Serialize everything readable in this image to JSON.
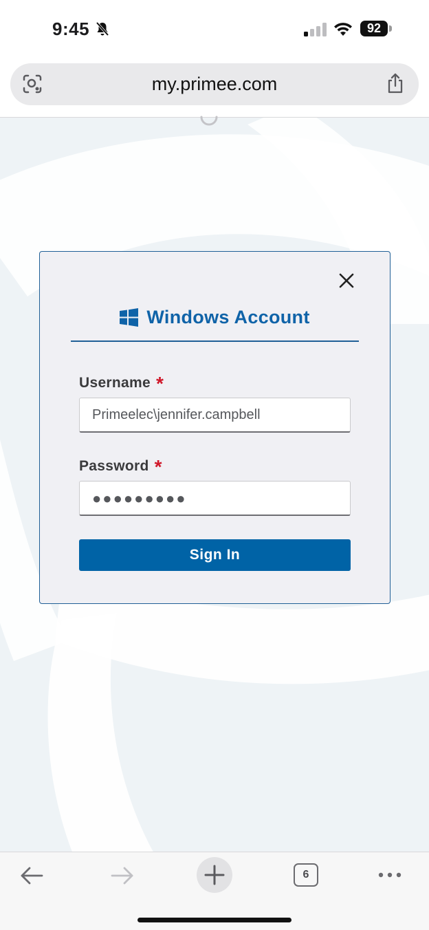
{
  "status_bar": {
    "time": "9:45",
    "battery": "92"
  },
  "browser": {
    "url": "my.primee.com",
    "tab_count": "6"
  },
  "dialog": {
    "title": "Windows Account",
    "username": {
      "label": "Username",
      "required_mark": "*",
      "value": "Primeelec\\jennifer.campbell"
    },
    "password": {
      "label": "Password",
      "required_mark": "*",
      "value": "●●●●●●●●●"
    },
    "submit_label": "Sign In"
  },
  "colors": {
    "accent": "#0063a6",
    "required": "#d0182a",
    "page_background": "#eef3f6"
  },
  "icons": [
    "bell-slash-icon",
    "signal-icon",
    "wifi-icon",
    "lens-icon",
    "share-icon",
    "close-icon",
    "windows-logo-icon",
    "back-icon",
    "forward-icon",
    "plus-icon",
    "more-icon"
  ]
}
